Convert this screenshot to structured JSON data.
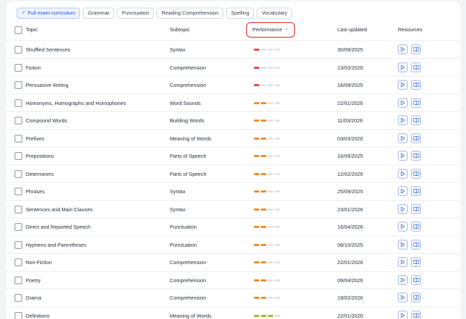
{
  "filters": [
    {
      "label": "Full exam curriculum",
      "active": true
    },
    {
      "label": "Grammar",
      "active": false
    },
    {
      "label": "Punctuation",
      "active": false
    },
    {
      "label": "Reading Comprehension",
      "active": false
    },
    {
      "label": "Spelling",
      "active": false
    },
    {
      "label": "Vocabulary",
      "active": false
    }
  ],
  "columns": {
    "topic": "Topic",
    "subtopic": "Subtopic",
    "performance": "Performance",
    "last_updated": "Last updated",
    "resources": "Resources"
  },
  "performance_colors": {
    "red": "#e04848",
    "orange": "#f08a24",
    "green": "#94c11f",
    "empty": "#e2e4e8"
  },
  "rows": [
    {
      "topic": "Shuffled Sentences",
      "subtopic": "Syntax",
      "level": 1,
      "color": "red",
      "updated": "30/09/2025"
    },
    {
      "topic": "Fiction",
      "subtopic": "Comprehension",
      "level": 1,
      "color": "red",
      "updated": "13/03/2026"
    },
    {
      "topic": "Persuasive Writing",
      "subtopic": "Comprehension",
      "level": 1,
      "color": "red",
      "updated": "16/09/2025"
    },
    {
      "topic": "Homonyms, Homographs and Homophones",
      "subtopic": "Word Sounds",
      "level": 2,
      "color": "orange",
      "updated": "22/01/2026"
    },
    {
      "topic": "Compound Words",
      "subtopic": "Building Words",
      "level": 2,
      "color": "orange",
      "updated": "11/03/2026"
    },
    {
      "topic": "Prefixes",
      "subtopic": "Meaning of Words",
      "level": 2,
      "color": "orange",
      "updated": "03/03/2026"
    },
    {
      "topic": "Prepositions",
      "subtopic": "Parts of Speech",
      "level": 2,
      "color": "orange",
      "updated": "16/09/2025"
    },
    {
      "topic": "Determiners",
      "subtopic": "Parts of Speech",
      "level": 2,
      "color": "orange",
      "updated": "12/02/2026"
    },
    {
      "topic": "Phrases",
      "subtopic": "Syntax",
      "level": 2,
      "color": "orange",
      "updated": "25/09/2025"
    },
    {
      "topic": "Sentences and Main Clauses",
      "subtopic": "Syntax",
      "level": 2,
      "color": "orange",
      "updated": "23/01/2026"
    },
    {
      "topic": "Direct and Reported Speech",
      "subtopic": "Punctuation",
      "level": 2,
      "color": "orange",
      "updated": "16/04/2026"
    },
    {
      "topic": "Hyphens and Parentheses",
      "subtopic": "Punctuation",
      "level": 2,
      "color": "orange",
      "updated": "08/10/2025"
    },
    {
      "topic": "Non-Fiction",
      "subtopic": "Comprehension",
      "level": 2,
      "color": "orange",
      "updated": "22/01/2026"
    },
    {
      "topic": "Poetry",
      "subtopic": "Comprehension",
      "level": 2,
      "color": "orange",
      "updated": "09/04/2026"
    },
    {
      "topic": "Drama",
      "subtopic": "Comprehension",
      "level": 2,
      "color": "orange",
      "updated": "19/02/2026"
    },
    {
      "topic": "Definitions",
      "subtopic": "Meaning of Words",
      "level": 3,
      "color": "green",
      "updated": "22/01/2026"
    }
  ],
  "icons": {
    "sort": "arrow-up-icon",
    "play": "play-icon",
    "book": "book-icon",
    "check": "checkmark-icon"
  }
}
